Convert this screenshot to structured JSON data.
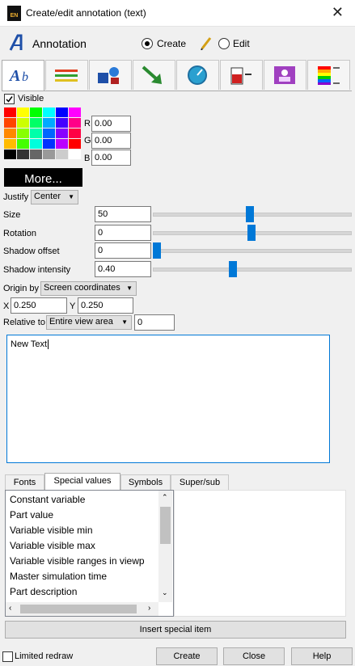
{
  "window": {
    "title": "Create/edit annotation (text)",
    "app_icon_label": "EN"
  },
  "header": {
    "annotation_label": "Annotation",
    "create_label": "Create",
    "edit_label": "Edit",
    "create_selected": true
  },
  "toolbar_tabs": [
    {
      "name": "text",
      "icon": "text-style-icon"
    },
    {
      "name": "lines",
      "icon": "lines-icon"
    },
    {
      "name": "shapes",
      "icon": "shapes-icon"
    },
    {
      "name": "arrow",
      "icon": "arrow-icon"
    },
    {
      "name": "dial",
      "icon": "dial-icon"
    },
    {
      "name": "gauge",
      "icon": "gauge-icon"
    },
    {
      "name": "logo",
      "icon": "logo-icon"
    },
    {
      "name": "legend",
      "icon": "legend-icon"
    }
  ],
  "visible": {
    "label": "Visible",
    "checked": true
  },
  "color": {
    "r_label": "R",
    "r_value": "0.00",
    "g_label": "G",
    "g_value": "0.00",
    "b_label": "B",
    "b_value": "0.00",
    "more_label": "More...",
    "palette": [
      [
        "#ff0000",
        "#ffff00",
        "#00ff00",
        "#00ffff",
        "#0000ff",
        "#ff00ff"
      ],
      [
        "#ff4400",
        "#ccff00",
        "#00ff66",
        "#00aaff",
        "#4400ff",
        "#ff0088"
      ],
      [
        "#ff8800",
        "#88ff00",
        "#00ffaa",
        "#0066ff",
        "#8800ff",
        "#ff0044"
      ],
      [
        "#ffbb00",
        "#44ff00",
        "#00ffdd",
        "#0033ff",
        "#bb00ff",
        "#ff0000"
      ],
      [
        "#000000",
        "#333333",
        "#666666",
        "#999999",
        "#cccccc",
        "#ffffff"
      ]
    ]
  },
  "justify": {
    "label": "Justify",
    "value": "Center"
  },
  "sliders": [
    {
      "label": "Size",
      "value": "50",
      "level": 0.49
    },
    {
      "label": "Rotation",
      "value": "0",
      "level": 0.5
    },
    {
      "label": "Shadow offset",
      "value": "0",
      "level": 0.0
    },
    {
      "label": "Shadow intensity",
      "value": "0.40",
      "level": 0.4
    }
  ],
  "origin": {
    "label": "Origin by",
    "value": "Screen coordinates",
    "x_label": "X",
    "x_value": "0.250",
    "y_label": "Y",
    "y_value": "0.250",
    "relative_label": "Relative to",
    "relative_value": "Entire view area",
    "relative_extra": "0"
  },
  "text_area": {
    "value": "New Text"
  },
  "lower_tabs": [
    {
      "label": "Fonts",
      "active": false
    },
    {
      "label": "Special values",
      "active": true
    },
    {
      "label": "Symbols",
      "active": false
    },
    {
      "label": "Super/sub",
      "active": false
    }
  ],
  "special_values": [
    "Constant variable",
    "Part value",
    "Variable visible min",
    "Variable visible max",
    "Variable visible ranges in viewp",
    "Master simulation time",
    "Part description"
  ],
  "insert_button": "Insert special item",
  "footer": {
    "limited_redraw": "Limited redraw",
    "create": "Create",
    "close": "Close",
    "help": "Help"
  }
}
